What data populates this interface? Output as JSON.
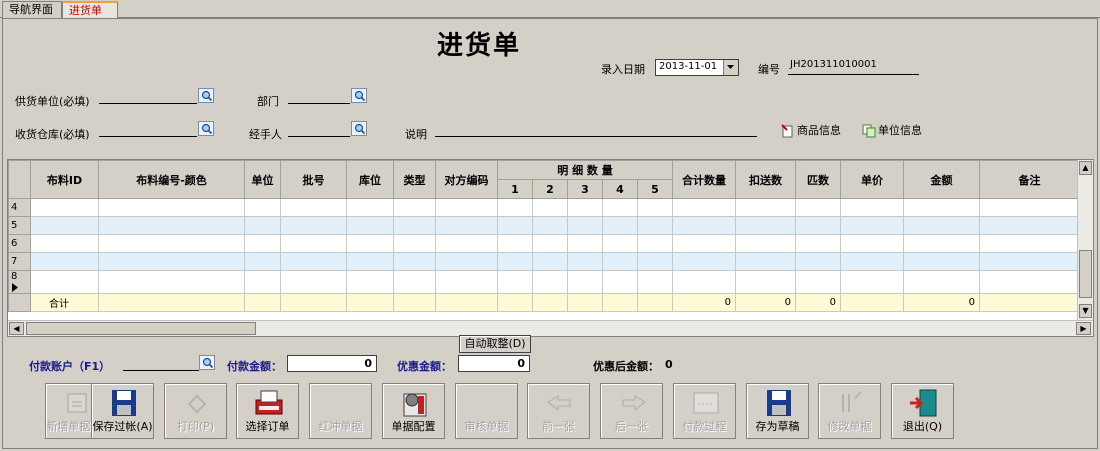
{
  "tabs": [
    {
      "label": "导航界面"
    },
    {
      "label": "进货单",
      "active": true
    }
  ],
  "form": {
    "title": "进货单",
    "entry_date_label": "录入日期",
    "entry_date_value": "2013-11-01",
    "code_label": "编号",
    "code_value": "JH201311010001",
    "supplier_label": "供货单位(必填)",
    "department_label": "部门",
    "warehouse_label": "收货仓库(必填)",
    "handler_label": "经手人",
    "note_label": "说明",
    "goods_info": "商品信息",
    "unit_info": "单位信息"
  },
  "grid": {
    "headers": {
      "fabric_id": "布料ID",
      "fabric_code": "布料编号-颜色",
      "unit": "单位",
      "batch": "批号",
      "location": "库位",
      "type": "类型",
      "counter_code": "对方编码",
      "detail_qty": "明 细 数 量",
      "sub": [
        "1",
        "2",
        "3",
        "4",
        "5"
      ],
      "total_qty": "合计数量",
      "discount_qty": "扣送数",
      "bolts": "匹数",
      "unit_price": "单价",
      "amount": "金额",
      "remark": "备注"
    },
    "row_numbers": [
      "4",
      "5",
      "6",
      "7",
      "8"
    ],
    "sum_row": {
      "label": "合计",
      "total_qty": "0",
      "discount_qty": "0",
      "bolts": "0",
      "amount": "0"
    }
  },
  "auto_round_button": "自动取整(D)",
  "payment": {
    "account_label": "付款账户（F1）",
    "amount_label": "付款金额：",
    "amount_value": "0",
    "discount_label": "优惠金额：",
    "discount_value": "0",
    "after_label": "优惠后金额：",
    "after_value": "0"
  },
  "toolbar": [
    {
      "label": "新增单据(Z)",
      "icon": "new-doc-icon",
      "enabled": false
    },
    {
      "label": "保存过帐(A)",
      "icon": "floppy-icon",
      "enabled": true
    },
    {
      "label": "打印(P)",
      "icon": "printer-icon",
      "enabled": false
    },
    {
      "label": "选择订单",
      "icon": "select-order-icon",
      "enabled": true
    },
    {
      "label": "红冲单据",
      "icon": "",
      "enabled": false
    },
    {
      "label": "单据配置",
      "icon": "config-icon",
      "enabled": true
    },
    {
      "label": "审核单据",
      "icon": "",
      "enabled": false
    },
    {
      "label": "前一张",
      "icon": "prev-hand-icon",
      "enabled": false
    },
    {
      "label": "后一张",
      "icon": "next-hand-icon",
      "enabled": false
    },
    {
      "label": "付款过程",
      "icon": "payment-icon",
      "enabled": false
    },
    {
      "label": "存为草稿",
      "icon": "floppy-icon",
      "enabled": true
    },
    {
      "label": "修改单据",
      "icon": "modify-icon",
      "enabled": false
    },
    {
      "label": "退出(Q)",
      "icon": "exit-door-icon",
      "enabled": true
    }
  ]
}
